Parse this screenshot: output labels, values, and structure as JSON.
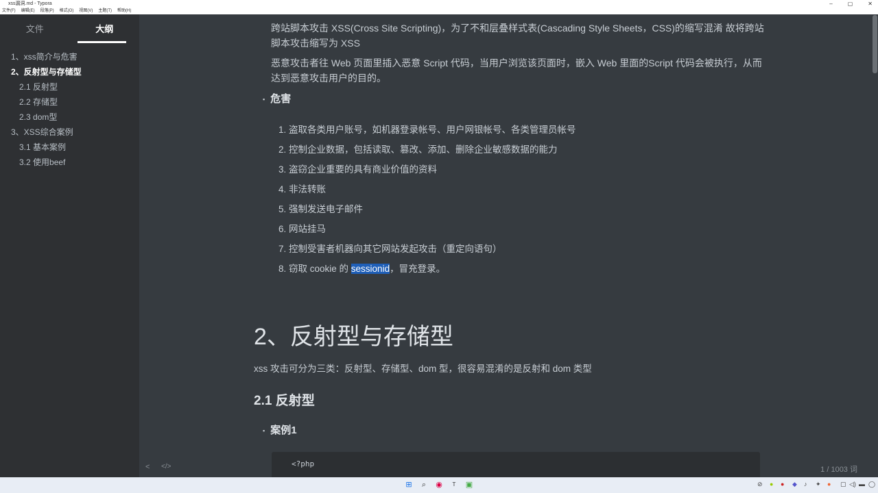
{
  "window": {
    "title": "xss漏洞.md - Typora",
    "controls": [
      "–",
      "▢",
      "✕"
    ]
  },
  "menu": [
    "文件(F)",
    "编辑(E)",
    "段落(P)",
    "格式(O)",
    "视图(V)",
    "主题(T)",
    "帮助(H)"
  ],
  "sidebar": {
    "tabs": [
      "文件",
      "大纲"
    ],
    "outline": [
      {
        "label": "1、xss简介与危害",
        "level": 1
      },
      {
        "label": "2、反射型与存储型",
        "level": 1,
        "active": true
      },
      {
        "label": "2.1 反射型",
        "level": 2
      },
      {
        "label": "2.2 存储型",
        "level": 2
      },
      {
        "label": "2.3 dom型",
        "level": 2
      },
      {
        "label": "3、XSS综合案例",
        "level": 1
      },
      {
        "label": "3.1 基本案例",
        "level": 2
      },
      {
        "label": "3.2 使用beef",
        "level": 2
      }
    ]
  },
  "content": {
    "p1": "跨站脚本攻击 XSS(Cross Site Scripting)，为了不和层叠样式表(Cascading Style Sheets，CSS)的缩写混淆 故将跨站脚本攻击缩写为 XSS",
    "p2": "恶意攻击者往 Web 页面里插入恶意 Script 代码，当用户浏览该页面时，嵌入 Web 里面的Script 代码会被执行，从而达到恶意攻击用户的目的。",
    "harm_heading": "危害",
    "harms": [
      "1. 盗取各类用户账号，如机器登录帐号、用户网银帐号、各类管理员帐号",
      "2. 控制企业数据，包括读取、篡改、添加、删除企业敏感数据的能力",
      "3. 盗窃企业重要的具有商业价值的资料",
      "4. 非法转账",
      "5. 强制发送电子邮件",
      "6. 网站挂马",
      "7. 控制受害者机器向其它网站发起攻击（重定向语句）"
    ],
    "harm8_pre": "8. 窃取 cookie 的 ",
    "harm8_hl": "sessionid",
    "harm8_post": "，冒充登录。",
    "h1": "2、反射型与存储型",
    "p3": "xss 攻击可分为三类：反射型、存储型、dom 型，很容易混淆的是反射和 dom 类型",
    "h2": "2.1 反射型",
    "case": "案例1",
    "code": "<?php"
  },
  "footer": {
    "back": "<",
    "source": "</>",
    "wordcount": "1 / 1003 词"
  }
}
